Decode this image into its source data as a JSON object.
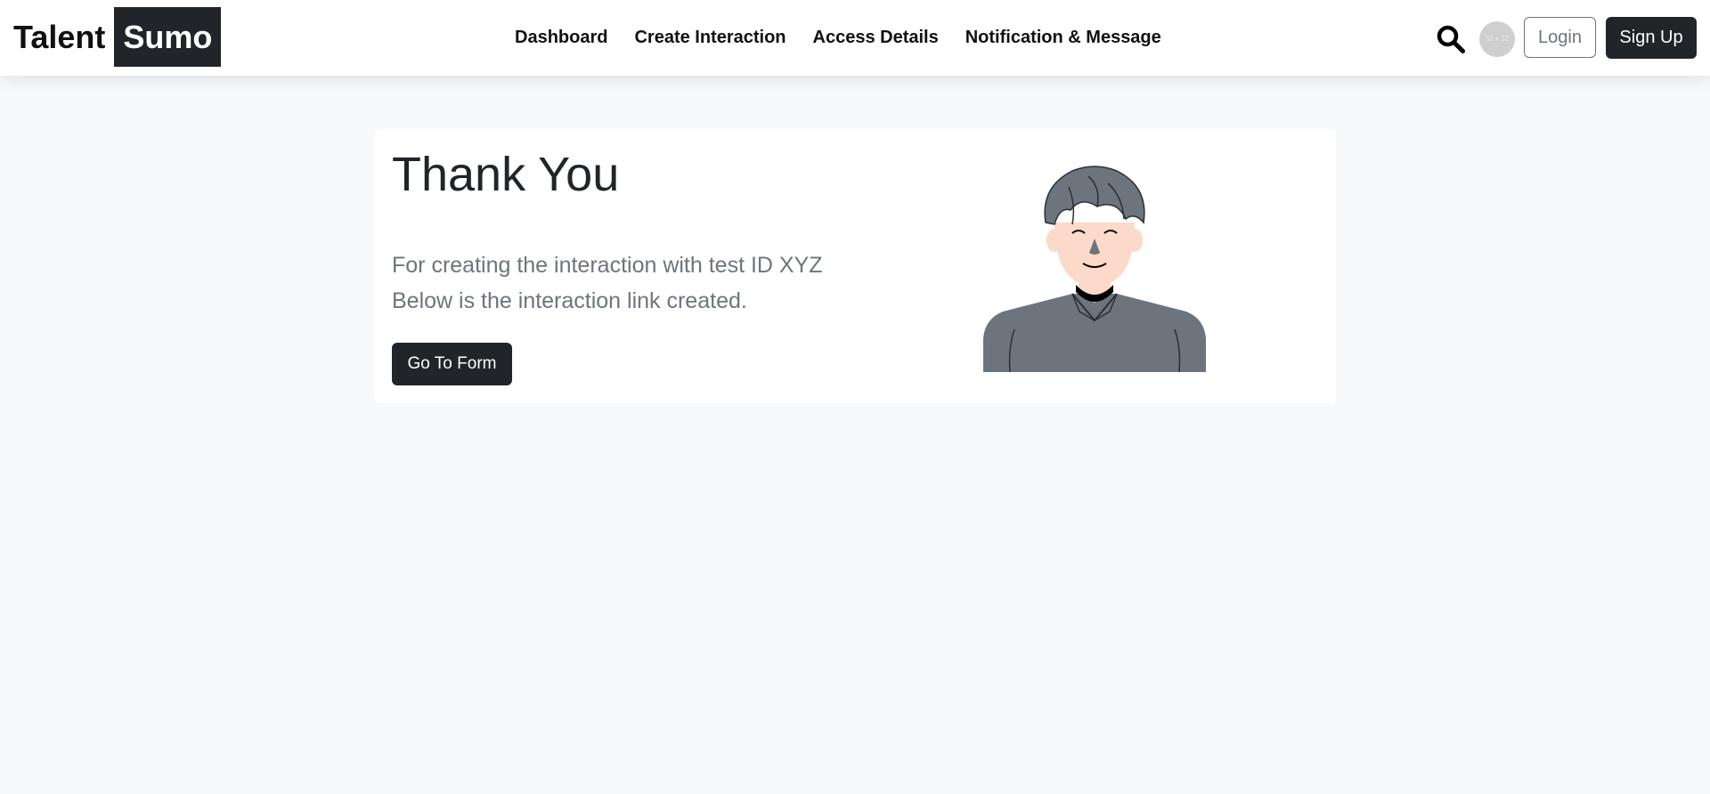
{
  "brand": {
    "part1": "Talent",
    "part2": "Sumo"
  },
  "nav": {
    "links": [
      "Dashboard",
      "Create Interaction",
      "Access Details",
      "Notification & Message"
    ]
  },
  "header_actions": {
    "search_icon": "search-icon",
    "avatar_text": "32 x 32",
    "login_label": "Login",
    "signup_label": "Sign Up"
  },
  "card": {
    "title": "Thank You",
    "line1": "For creating the interaction with test ID XYZ",
    "line2": "Below is the interaction link created.",
    "button_label": "Go To Form",
    "illustration": "person-illustration"
  },
  "colors": {
    "page_bg": "#f8f9fa",
    "dark": "#212529",
    "muted": "#6c757d",
    "shirt": "#6c757d",
    "skin": "#fcd9c8"
  }
}
